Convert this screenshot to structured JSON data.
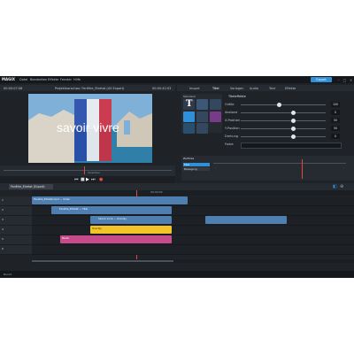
{
  "app": {
    "logo": "MAGIX",
    "menu": [
      "Datei",
      "Bearbeiten",
      "Effekte",
      "Fenster",
      "Hilfe"
    ],
    "export_label": "Export"
  },
  "preview": {
    "timecode_left": "00:00:07:08",
    "project_title": "Projektvorschau: Fenêtre_Etretat (A5 Export)",
    "timecode_right": "00:00:42:03",
    "overlay_text": "savoir vivre",
    "mini_label": "Vorschau"
  },
  "panel": {
    "tabs": [
      "Import",
      "Titel",
      "Vorlagen",
      "Audio",
      "Text",
      "Effekte"
    ],
    "active_tab": 1,
    "section_title": "Titeleffekte",
    "category_label": "Standard",
    "params": [
      {
        "label": "Größe",
        "value": "100",
        "level": 0.45
      },
      {
        "label": "Abstand",
        "value": "0",
        "level": 0.62
      },
      {
        "label": "X-Position",
        "value": "50",
        "level": 0.62
      },
      {
        "label": "Y-Position",
        "value": "50",
        "level": 0.62
      },
      {
        "label": "Drehung",
        "value": "0",
        "level": 0.62
      },
      {
        "label": "Farbe",
        "value": "",
        "level": 0.0
      }
    ],
    "subpanel_title": "Zeitlinie",
    "subpanel_items": [
      "Titel",
      "Bewegung"
    ]
  },
  "timeline": {
    "tab_label": "Fenêtre_Etretat (Export)",
    "ruler_label": "00:00:00",
    "tracks": [
      {
        "index": "1",
        "clips": [
          {
            "label": "Fenêtre_Etretat.mp4 — Video"
          }
        ]
      },
      {
        "index": "2",
        "clips": [
          {
            "label": "Fenêtre_Etretat — Titel"
          }
        ]
      },
      {
        "index": "3",
        "clips": [
          {
            "label": "Savoir vivre — Overlay"
          }
        ]
      },
      {
        "index": "4",
        "clips": [
          {
            "label": "Overlay"
          }
        ]
      },
      {
        "index": "5",
        "clips": [
          {
            "label": "Musik"
          }
        ]
      },
      {
        "index": "6",
        "clips": []
      }
    ]
  },
  "colors": {
    "accent": "#2f8fd8",
    "clip_blue": "#4f7fb0",
    "clip_yellow": "#f2c42a",
    "clip_pink": "#c74a8a",
    "flag_blue": "#2748a8",
    "flag_red": "#d8283a"
  },
  "status": {
    "text": "Bereit"
  }
}
